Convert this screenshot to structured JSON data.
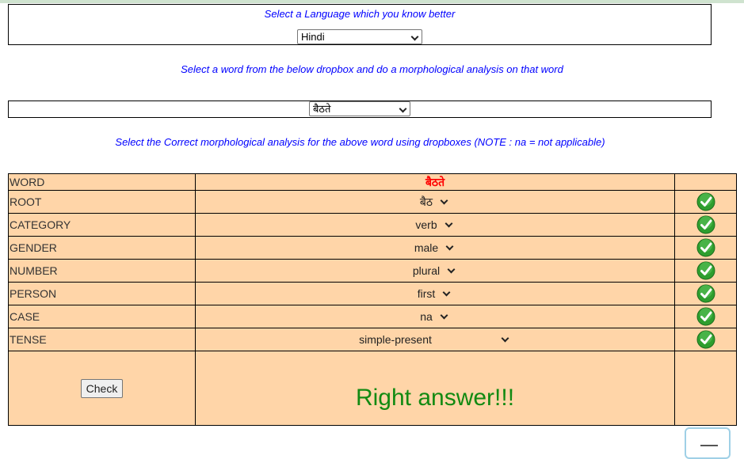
{
  "language_section": {
    "label": "Select a Language which you know better",
    "selected": "Hindi"
  },
  "word_section": {
    "instruction": "Select a word from the below dropbox and do a morphological analysis on that word",
    "selected": "बैठते"
  },
  "analysis_instruction": "Select the Correct morphological analysis for the above word using dropboxes (NOTE : na = not applicable)",
  "table": {
    "word_label": "WORD",
    "word_value": "बैठते",
    "rows": [
      {
        "label": "ROOT",
        "value": "बैठ",
        "result": "correct-tick-icon"
      },
      {
        "label": "CATEGORY",
        "value": "verb",
        "result": "correct-tick-icon"
      },
      {
        "label": "GENDER",
        "value": "male",
        "result": "correct-tick-icon"
      },
      {
        "label": "NUMBER",
        "value": "plural",
        "result": "correct-tick-icon"
      },
      {
        "label": "PERSON",
        "value": "first",
        "result": "correct-tick-icon"
      },
      {
        "label": "CASE",
        "value": "na",
        "result": "correct-tick-icon"
      },
      {
        "label": "TENSE",
        "value": "simple-present",
        "result": "correct-tick-icon"
      }
    ],
    "check_button": "Check",
    "result_message": "Right answer!!!"
  },
  "colors": {
    "instruction_text": "#0000ff",
    "table_background": "#ffd5a8",
    "word_highlight": "#ff0000",
    "result_message": "#128a12",
    "tick": "#2e9e2e"
  },
  "floating_menu": {
    "icon": "menu-icon"
  }
}
